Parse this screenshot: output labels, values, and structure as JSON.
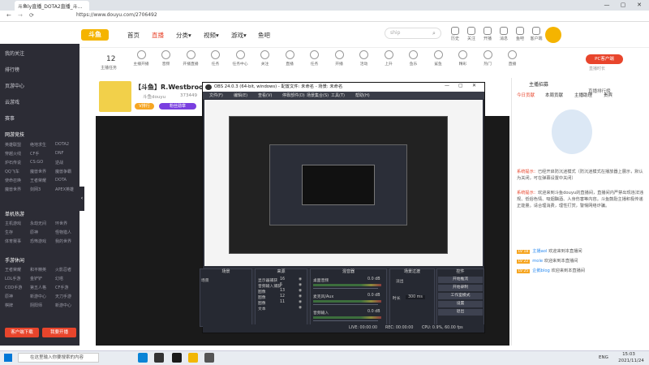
{
  "browser": {
    "tab_title": "斗鱼ly直播_DOTA2直播_斗...",
    "url": "https://www.douyu.com/2706492",
    "window_controls": [
      "—",
      "▢",
      "✕"
    ]
  },
  "header": {
    "logo": "斗鱼",
    "nav": [
      "首页",
      "直播",
      "分类▾",
      "视频▾",
      "游戏▾",
      "鱼吧"
    ],
    "search_placeholder": "ship",
    "icons": [
      "历史",
      "关注",
      "开播",
      "消息",
      "鱼吧",
      "客户端"
    ]
  },
  "row2": {
    "count": "12",
    "count_label": "主播任务",
    "items": [
      "主播开播",
      "音频",
      "开播直播",
      "任务",
      "任务中心",
      "关注",
      "直播",
      "任务",
      "开播",
      "活动",
      "上升",
      "鱼乐",
      "鲨鱼",
      "精彩",
      "热门",
      "直播"
    ],
    "pc_button": "PC客户端",
    "pc_sub": "直播时长"
  },
  "sidebar": {
    "items": [
      "我的关注",
      "排行榜",
      "页游中心",
      "云游戏",
      "赛事",
      "鱼吧"
    ],
    "section1": "网游竞技",
    "section1_games": [
      "英雄联盟",
      "绝地求生",
      "DOTA2",
      "穿越火线",
      "CF手",
      "DNF",
      "炉石传说",
      "CS:GO",
      "逆战",
      "QQ飞车",
      "魔兽世界",
      "魔兽争霸",
      "使命召唤",
      "王者荣耀",
      "DOTA",
      "魔兽世界",
      "剑网3",
      "APEX英雄"
    ],
    "section2": "单机热游",
    "section2_games": [
      "主机游戏",
      "永劫无间",
      "环世界",
      "生存",
      "原神",
      "怪物猎人",
      "体育赛事",
      "恐怖游戏",
      "我的世界"
    ],
    "section3": "手游休闲",
    "section3_games": [
      "王者荣耀",
      "和平精英",
      "火影忍者",
      "LOL手游",
      "金铲铲",
      "幻塔",
      "COD手游",
      "第五人格",
      "CF手游",
      "原神",
      "新游中心",
      "天刀手游",
      "棋牌",
      "阴阳师",
      "新游中心"
    ],
    "btn_client": "客户端下载",
    "btn_live": "我要开播"
  },
  "stream": {
    "title": "【斗鱼】R.Westbrook",
    "room": "斗鱼douyu",
    "hot": "373449",
    "badge1": "V排行",
    "badge2": "粉丝勋章"
  },
  "right_panel": {
    "header": "主播招募",
    "rank_link": "直播排行榜",
    "tabs": [
      "今日贡献",
      "本周贡献",
      "主播助理",
      "贵宾"
    ],
    "chat": [
      {
        "kind": "系统提示",
        "text": "已经开启防沉迷模式（防沉迷模式在播放器上展示，默认为关闭，可在弹幕设置中关闭）"
      },
      {
        "kind": "系统提示",
        "text": "欢迎来到斗鱼douyu的直播间，直播间内严禁出现违法违规、低俗色情、吸烟酗酒、人身伤害等内容。斗鱼鼓励主播积极传递正能量。请合理消费，理性打赏，警惕网络诈骗。"
      },
      {
        "kind": "user",
        "level": "LV 18",
        "name": "主播aol",
        "text": "欢迎来到本直播间"
      },
      {
        "kind": "user",
        "level": "LV 22",
        "name": "mole",
        "text": "欢迎来到本直播间"
      },
      {
        "kind": "user",
        "level": "LV 25",
        "name": "企鹅blog",
        "text": "欢迎来到本直播间"
      }
    ]
  },
  "obs": {
    "title": "OBS 24.0.3 (64-bit, windows) - 配置文件: 未命名 - 场景: 未命名",
    "menu": [
      "文件(F)",
      "编辑(E)",
      "查看(V)",
      "停靠部件(D)",
      "场景集合(S)",
      "工具(T)",
      "帮助(H)"
    ],
    "docks": {
      "scenes": {
        "title": "场景",
        "items": [
          "场景"
        ]
      },
      "sources": {
        "title": "来源",
        "items": [
          "显示器捕获",
          "音频输入捕获",
          "图像",
          "图像",
          "图像",
          "文本"
        ],
        "nums": [
          "16",
          "5",
          "13",
          "12",
          "11"
        ]
      },
      "mixer": {
        "title": "混音器",
        "channels": [
          {
            "name": "桌面音频",
            "db": "0.0 dB"
          },
          {
            "name": "麦克风/Aux",
            "db": "0.0 dB"
          },
          {
            "name": "音频输入",
            "db": "0.0 dB"
          }
        ]
      },
      "transitions": {
        "title": "场景过渡",
        "type": "淡出",
        "duration_label": "时长",
        "duration": "300 ms"
      },
      "controls": {
        "title": "控件",
        "buttons": [
          "开始推流",
          "开始录制",
          "工作室模式",
          "设置",
          "退出"
        ]
      }
    },
    "status": {
      "live": "LIVE: 00:00:00",
      "rec": "REC: 00:00:00",
      "cpu": "CPU: 0.9%, 60.00 fps"
    }
  },
  "taskbar": {
    "search": "在这里输入你要搜索的内容",
    "tray": [
      "ENG"
    ],
    "time": "15:03",
    "date": "2021/11/24"
  },
  "colors": {
    "accent": "#e8452c",
    "sidebar": "#2c2c35",
    "obs_bg": "#2b2e38"
  }
}
